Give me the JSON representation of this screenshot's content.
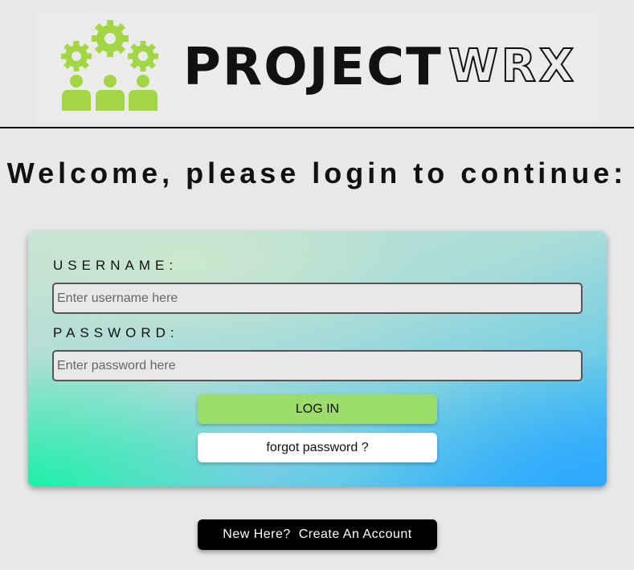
{
  "brand": {
    "name_primary": "PROJECT",
    "name_secondary": "WRX",
    "logo_icon": "team-gears-icon",
    "accent_color": "#a3d645"
  },
  "welcome": {
    "heading": "Welcome, please login to continue:"
  },
  "login_form": {
    "username_label": "USERNAME:",
    "username_value": "",
    "username_placeholder": "Enter username here",
    "password_label": "PASSWORD:",
    "password_value": "",
    "password_placeholder": "Enter password here",
    "login_button": "LOG IN",
    "forgot_button": "forgot password ?"
  },
  "signup": {
    "create_account_button": "New Here?  Create An Account"
  },
  "colors": {
    "login_button": "#9bdc6a",
    "gradient_green": "#1ef0a8",
    "gradient_blue": "#2ea8ff"
  }
}
